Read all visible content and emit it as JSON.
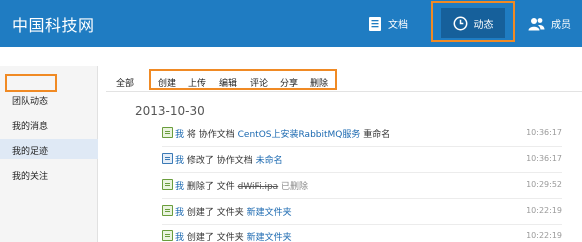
{
  "brand": "中国科技网",
  "nav": {
    "docs": "文档",
    "activity": "动态",
    "members": "成员"
  },
  "sidebar": {
    "items": [
      {
        "label": "团队动态"
      },
      {
        "label": "我的消息"
      },
      {
        "label": "我的足迹"
      },
      {
        "label": "我的关注"
      }
    ]
  },
  "filters": {
    "all": "全部",
    "create": "创建",
    "upload": "上传",
    "edit": "编辑",
    "comment": "评论",
    "share": "分享",
    "delete": "删除"
  },
  "date": "2013-10-30",
  "entries": [
    {
      "actor": "我",
      "verb": "将 协作文档",
      "target": "CentOS上安装RabbitMQ服务",
      "suffix": "重命名",
      "time": "10:36:17"
    },
    {
      "actor": "我",
      "verb": "修改了 协作文档",
      "target": "未命名",
      "suffix": "",
      "time": "10:36:17"
    },
    {
      "actor": "我",
      "verb": "删除了 文件",
      "target": "dWiFi.ipa",
      "suffix": "已删除",
      "time": "10:29:52"
    },
    {
      "actor": "我",
      "verb": "创建了 文件夹",
      "target": "新建文件夹",
      "suffix": "",
      "time": "10:22:19"
    },
    {
      "actor": "我",
      "verb": "创建了 文件夹",
      "target": "新建文件夹",
      "suffix": "",
      "time": "10:22:19"
    }
  ],
  "colors": {
    "topbar": "#1f7cc2",
    "highlight": "#f08a24",
    "link": "#1a68b0"
  }
}
